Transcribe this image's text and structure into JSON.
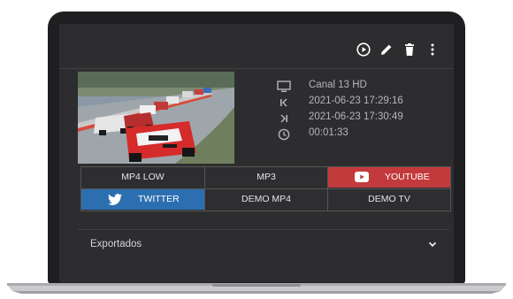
{
  "media": {
    "channel": "Canal 13 HD",
    "start": "2021-06-23 17:29:16",
    "end": "2021-06-23 17:30:49",
    "duration": "00:01:33"
  },
  "exports": {
    "row1": [
      "MP4 LOW",
      "MP3",
      "YOUTUBE"
    ],
    "row2": [
      "TWITTER",
      "DEMO MP4",
      "DEMO TV"
    ]
  },
  "accordion": {
    "label": "Exportados"
  },
  "colors": {
    "youtube": "#c33a3c",
    "twitter": "#2c6fb0",
    "screen_bg": "#2d2d2f"
  },
  "icons": {
    "toolbar": [
      "play-icon",
      "edit-icon",
      "delete-icon",
      "more-vertical-icon"
    ],
    "info": [
      "monitor-icon",
      "start-marker-icon",
      "end-marker-icon",
      "clock-icon"
    ],
    "buttons": [
      "youtube-icon",
      "twitter-icon"
    ],
    "accordion": "chevron-down-icon"
  }
}
